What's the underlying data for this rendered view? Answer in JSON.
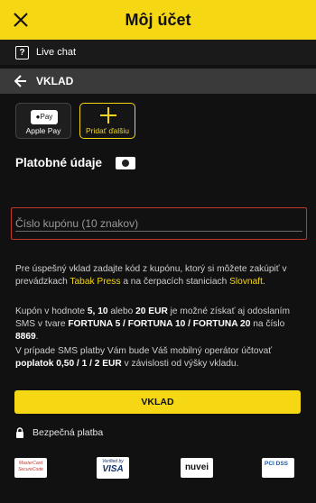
{
  "header": {
    "title": "Môj účet",
    "close_icon": "close-icon"
  },
  "livechat": {
    "icon": "chat-question-icon",
    "label": "Live chat"
  },
  "section": {
    "back_icon": "arrow-left-icon",
    "title": "VKLAD"
  },
  "payment_methods": [
    {
      "badge": "Pay",
      "label": "Apple Pay"
    },
    {
      "icon": "plus-icon",
      "label": "Pridať ďalšiu"
    }
  ],
  "payment_details": {
    "title": "Platobné údaje",
    "icon": "card-icon"
  },
  "coupon": {
    "placeholder": "Číslo kupónu (10 znakov)",
    "value": ""
  },
  "info": {
    "p1_a": "Pre úspešný vklad zadajte kód z kupónu, ktorý si môžete zakúpiť v prevádzkach ",
    "p1_link1": "Tabak Press",
    "p1_b": " a na čerpacích staniciach ",
    "p1_link2": "Slovnaft",
    "p1_c": ".",
    "p2_a": "Kupón v hodnote ",
    "p2_b1": "5, 10",
    "p2_c": " alebo ",
    "p2_b2": "20 EUR",
    "p2_d": " je možné získať aj odoslaním SMS v tvare ",
    "p2_b3": "FORTUNA 5 / FORTUNA 10 / FORTUNA 20",
    "p2_e": " na číslo ",
    "p2_b4": "8869",
    "p2_f": ".",
    "p3_a": "V prípade SMS platby Vám bude Váš mobilný operátor účtovať ",
    "p3_b1": "poplatok 0,50 / 1 / 2 EUR",
    "p3_c": " v závislosti od výšky vkladu."
  },
  "submit": {
    "label": "VKLAD"
  },
  "secure": {
    "icon": "lock-icon",
    "label": "Bezpečná platba"
  },
  "logos": {
    "mastercard": "MasterCard SecureCode",
    "visa_top": "Verified by",
    "visa_main": "VISA",
    "nuvei": "nuvei",
    "pci": "PCI DSS"
  },
  "colors": {
    "accent": "#f5d714",
    "background": "#111111",
    "error_border": "#c0392b"
  }
}
